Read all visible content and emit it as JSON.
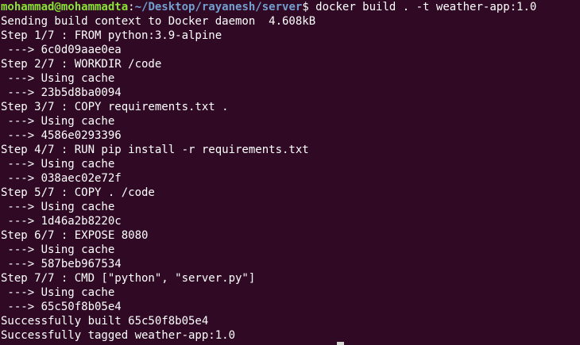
{
  "prompt": {
    "user_host": "mohammad@mohammadta",
    "separator": ":",
    "path": "~/Desktop/rayanesh/server",
    "symbol": "$",
    "command": " docker build . -t weather-app:1.0"
  },
  "output": [
    "Sending build context to Docker daemon  4.608kB",
    "Step 1/7 : FROM python:3.9-alpine",
    " ---> 6c0d09aae0ea",
    "Step 2/7 : WORKDIR /code",
    " ---> Using cache",
    " ---> 23b5d8ba0094",
    "Step 3/7 : COPY requirements.txt .",
    " ---> Using cache",
    " ---> 4586e0293396",
    "Step 4/7 : RUN pip install -r requirements.txt",
    " ---> Using cache",
    " ---> 038aec02e72f",
    "Step 5/7 : COPY . /code",
    " ---> Using cache",
    " ---> 1d46a2b8220c",
    "Step 6/7 : EXPOSE 8080",
    " ---> Using cache",
    " ---> 587beb967534",
    "Step 7/7 : CMD [\"python\", \"server.py\"]",
    " ---> Using cache",
    " ---> 65c50f8b05e4",
    "Successfully built 65c50f8b05e4",
    "Successfully tagged weather-app:1.0"
  ]
}
